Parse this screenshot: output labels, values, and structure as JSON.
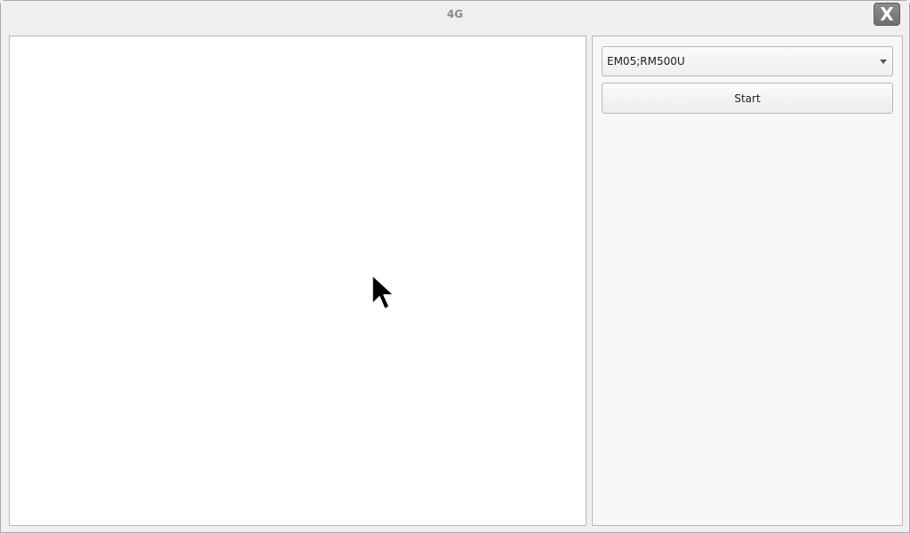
{
  "window": {
    "title": "4G",
    "close_label": "X"
  },
  "controls": {
    "model_select": {
      "value": "EM05;RM500U"
    },
    "start_label": "Start"
  },
  "icons": {
    "close": "close-icon",
    "dropdown": "chevron-down-icon",
    "pointer": "mouse-pointer-icon"
  }
}
